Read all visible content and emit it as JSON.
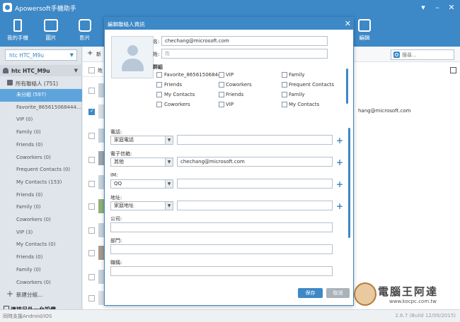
{
  "app": {
    "title": "Apowersoft手機助手"
  },
  "toolbar": {
    "items": [
      {
        "label": "我的手機",
        "icon": "phone-icon"
      },
      {
        "label": "圖片",
        "icon": "image-icon"
      },
      {
        "label": "影片",
        "icon": "video-icon"
      },
      {
        "label": "",
        "icon": "file-icon"
      },
      {
        "label": "",
        "icon": "sms-icon"
      },
      {
        "label": "",
        "icon": "app-icon"
      },
      {
        "label": "",
        "icon": "book-icon"
      },
      {
        "label": "編輯",
        "icon": "edit-icon"
      }
    ]
  },
  "sidebar": {
    "device_select": "htc HTC_M9u",
    "device_name": "htc HTC_M9u",
    "all_contacts": "所有聯絡人 (751)",
    "groups": [
      "未分組 (597)",
      "Favorite_865615068444...",
      "VIP (0)",
      "Family (0)",
      "Friends (0)",
      "Coworkers (0)",
      "Frequent Contacts (0)",
      "My Contacts (153)",
      "Friends (0)",
      "Family (0)",
      "Coworkers (0)",
      "VIP (3)",
      "My Contacts (0)",
      "Friends (0)",
      "Family (0)",
      "Coworkers (0)"
    ],
    "new_group": "新建分組...",
    "connect": "連接另外一台設備"
  },
  "list": {
    "new_label": "新",
    "search_placeholder": "搜尋...",
    "header_label": "姓",
    "detail_email": "hang@microsoft.com"
  },
  "dialog": {
    "title": "編輯聯絡人資訊",
    "first_name_label": "名:",
    "first_name_value": "chechang@microsoft.com",
    "last_name_label": "姓:",
    "last_name_placeholder": "姓",
    "group_label": "群組",
    "groups": [
      {
        "label": "Favorite_86561506844"
      },
      {
        "label": "VIP"
      },
      {
        "label": "Family"
      },
      {
        "label": "Friends"
      },
      {
        "label": "Coworkers"
      },
      {
        "label": "Frequent Contacts"
      },
      {
        "label": "My Contacts"
      },
      {
        "label": "Friends"
      },
      {
        "label": "Family"
      },
      {
        "label": "Coworkers"
      },
      {
        "label": "VIP"
      },
      {
        "label": "My Contacts"
      }
    ],
    "phone_label": "電話:",
    "phone_type": "家庭電話",
    "phone_value": "",
    "email_label": "電子信箱:",
    "email_type": "其他",
    "email_value": "chechang@microsoft.com",
    "im_label": "IM:",
    "im_type": "QQ",
    "im_value": "",
    "address_label": "地址:",
    "address_type": "家庭地址",
    "address_value": "",
    "company_label": "公司:",
    "department_label": "部門:",
    "job_label": "職稱:",
    "save_label": "保存",
    "cancel_label": "取消"
  },
  "footer": {
    "support": "同時支援Android/iOS",
    "version": "2.6.7 (Build 12/09/2015)"
  },
  "watermark": {
    "text": "電腦王阿達",
    "url": "www.kocpc.com.tw"
  }
}
